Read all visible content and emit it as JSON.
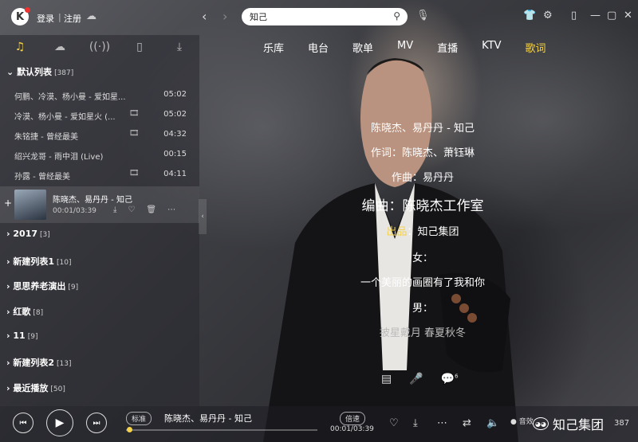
{
  "topbar": {
    "logo": "K",
    "login": "登录",
    "separator": "|",
    "register": "注册",
    "search": {
      "value": "知己",
      "placeholder": "知己"
    }
  },
  "nav": {
    "tabs": [
      "乐库",
      "电台",
      "歌单",
      "MV",
      "直播",
      "KTV",
      "歌词"
    ],
    "active_index": 6
  },
  "sidebar": {
    "default_list": {
      "label": "默认列表",
      "count": "[387]"
    },
    "songs": [
      {
        "title": "何鹏、冷漠、杨小曼 - 爱如星...",
        "duration": "05:02",
        "mv": false
      },
      {
        "title": "冷漠、杨小曼 - 爱如星火 (...",
        "duration": "05:02",
        "mv": true
      },
      {
        "title": "朱铭捷 - 曾经最美",
        "duration": "04:32",
        "mv": true
      },
      {
        "title": "绍兴龙哥 - 雨中泪 (Live)",
        "duration": "00:15",
        "mv": false
      },
      {
        "title": "孙露 - 曾经最美",
        "duration": "04:11",
        "mv": true
      }
    ],
    "now_playing": {
      "title": "陈晓杰、易丹丹 - 知己",
      "time": "00:01/03:39"
    },
    "groups": [
      {
        "label": "2017",
        "count": "[3]"
      },
      {
        "label": "新建列表1",
        "count": "[10]"
      },
      {
        "label": "思思养老演出",
        "count": "[9]"
      },
      {
        "label": "红歌",
        "count": "[8]"
      },
      {
        "label": "11",
        "count": "[9]"
      },
      {
        "label": "新建列表2",
        "count": "[13]"
      },
      {
        "label": "最近播放",
        "count": "[50]"
      }
    ]
  },
  "lyrics": {
    "l1": "陈晓杰、易丹丹 - 知己",
    "l2": "作词：陈晓杰、萧钰琳",
    "l3": "作曲：易丹丹",
    "l4": "编曲：陈晓杰工作室",
    "l5_gold": "出品",
    "l5_rest": "：知己集团",
    "l6": "女：",
    "l7": "一个美丽的画圈有了我和你",
    "l8": "男：",
    "l9": "披星戴月 春夏秋冬"
  },
  "lyric_tools": {
    "comment_badge": "6"
  },
  "player": {
    "quality": "标准",
    "title": "陈晓杰、易丹丹 - 知己",
    "speed": "倍速",
    "time": "00:01/03:39",
    "progress_fraction": 0.005,
    "sound_label": "音效",
    "watermark": "知己集团",
    "playlist_count": "387"
  },
  "colors": {
    "accent": "#f4d24a",
    "badge": "#e33333"
  }
}
